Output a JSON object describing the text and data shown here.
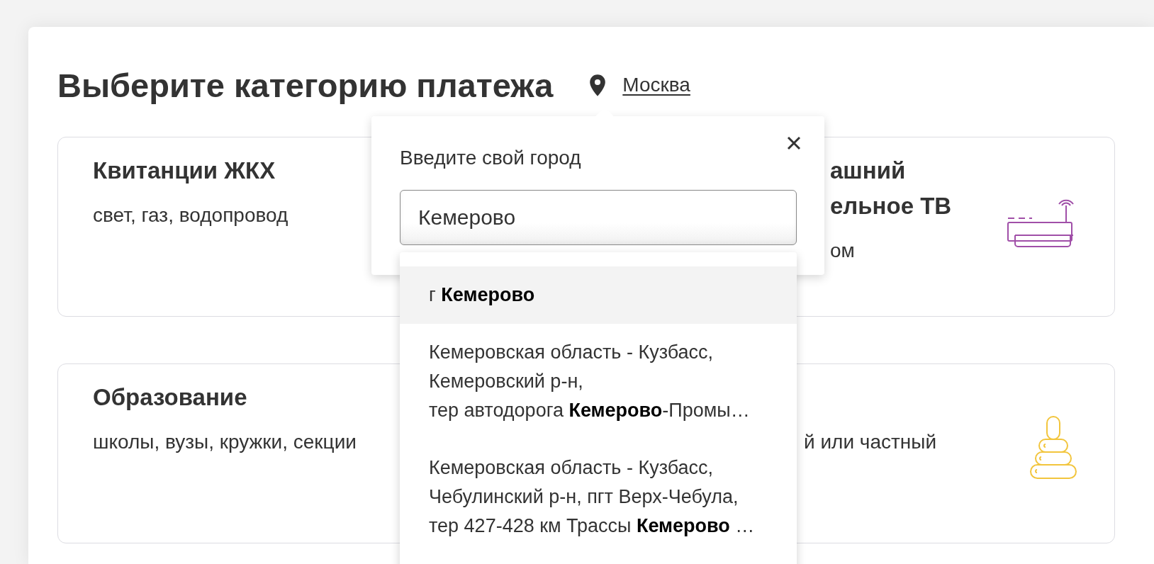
{
  "header": {
    "title": "Выберите категорию платежа",
    "city": "Москва"
  },
  "categories": [
    {
      "title_lines": [
        "Квитанции ЖКХ"
      ],
      "subtitle": "свет, газ, водопровод"
    },
    {
      "kind": "router",
      "title_lines": [
        "ашний",
        "ельное ТВ"
      ],
      "subtitle": "ом"
    },
    {
      "title_lines": [
        "Образование"
      ],
      "subtitle": "школы, вузы, кружки, секции"
    },
    {
      "kind": "pyramid",
      "subtitle": "й или частный"
    }
  ],
  "city_popup": {
    "label": "Введите свой город",
    "input": {
      "value": "Кемерово"
    },
    "suggestions": [
      {
        "lines": [
          "г **Кемерово**"
        ],
        "selected": true
      },
      {
        "lines": [
          "Кемеровская область - Кузбасс,",
          "Кемеровский р-н,",
          "тер автодорога **Кемерово**-Промы…"
        ],
        "selected": false
      },
      {
        "lines": [
          "Кемеровская область - Кузбасс,",
          "Чебулинский р-н, пгт Верх-Чебула,",
          "тер 427-428 км Трассы **Кемерово** …"
        ],
        "selected": false
      }
    ]
  }
}
